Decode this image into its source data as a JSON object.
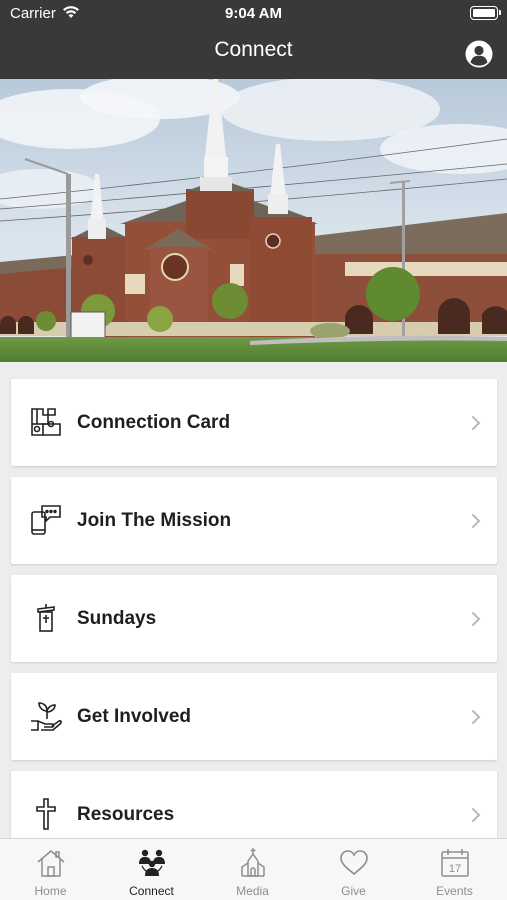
{
  "status_bar": {
    "carrier": "Carrier",
    "time": "9:04 AM"
  },
  "nav": {
    "title": "Connect"
  },
  "hero": {
    "sign_text": ""
  },
  "menu": [
    {
      "label": "Connection Card",
      "icon": "puzzle-icon"
    },
    {
      "label": "Join The Mission",
      "icon": "phone-chat-icon"
    },
    {
      "label": "Sundays",
      "icon": "pulpit-icon"
    },
    {
      "label": "Get Involved",
      "icon": "hand-plant-icon"
    },
    {
      "label": "Resources",
      "icon": "cross-icon"
    }
  ],
  "tabs": [
    {
      "label": "Home",
      "icon": "home-icon",
      "active": false
    },
    {
      "label": "Connect",
      "icon": "people-icon",
      "active": true
    },
    {
      "label": "Media",
      "icon": "church-icon",
      "active": false
    },
    {
      "label": "Give",
      "icon": "heart-icon",
      "active": false
    },
    {
      "label": "Events",
      "icon": "calendar-icon",
      "active": false
    }
  ],
  "calendar_day": "17",
  "colors": {
    "header": "#393939",
    "card": "#ffffff",
    "page_bg": "#ededed",
    "tab_inactive": "#8e8e8e",
    "tab_active": "#222222"
  }
}
